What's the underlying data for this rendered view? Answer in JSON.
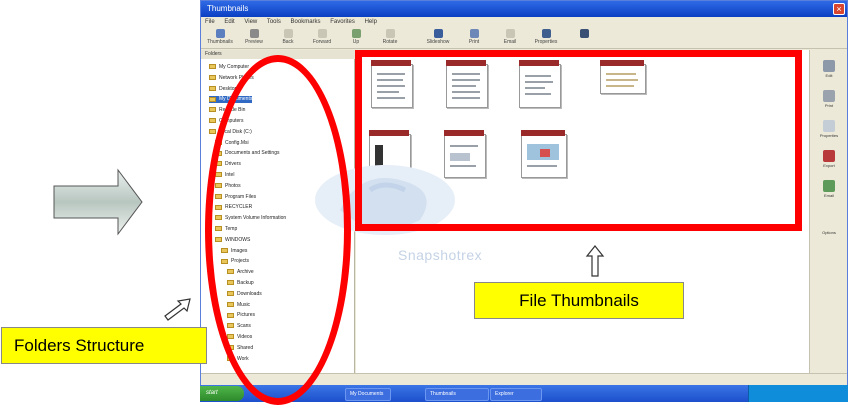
{
  "window": {
    "title": "Thumbnails",
    "menu": [
      "File",
      "Edit",
      "View",
      "Tools",
      "Bookmarks",
      "Favorites",
      "Help"
    ],
    "toolbar": [
      "Thumbnails",
      "Preview",
      "Back",
      "Forward",
      "Up",
      "Rotate",
      "Slideshow",
      "Print",
      "Email",
      "Properties"
    ]
  },
  "tree": {
    "header": "Folders",
    "items": [
      "My Computer",
      "Network Places",
      "Desktop",
      "My Documents",
      "Recycle Bin",
      "Computers",
      "Local Disk (C:)",
      "Config.Msi",
      "Documents and Settings",
      "Drivers",
      "Intel",
      "Photos",
      "Program Files",
      "RECYCLER",
      "System Volume Information",
      "Temp",
      "WINDOWS",
      "Images",
      "Projects",
      "Archive",
      "Backup",
      "Downloads",
      "Music",
      "Pictures",
      "Scans",
      "Videos",
      "Shared",
      "Work"
    ]
  },
  "thumbnails": {
    "count": 7,
    "watermark": "Snapshotrex"
  },
  "sidebar": [
    "Edit",
    "Print",
    "Properties",
    "Export",
    "Email",
    "Options"
  ],
  "taskbar": {
    "start": "start",
    "tasks": [
      "My Documents",
      "Thumbnails",
      "Explorer"
    ]
  },
  "annotations": {
    "thumbnails_label": "File Thumbnails",
    "folders_label": "Folders Structure"
  },
  "colors": {
    "annotation_red": "#ff0000",
    "callout_yellow": "#ffff00",
    "titlebar_blue": "#0b3fc3"
  }
}
